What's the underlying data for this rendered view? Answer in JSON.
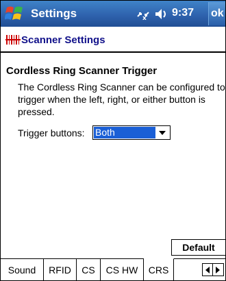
{
  "titlebar": {
    "app_title": "Settings",
    "clock": "9:37",
    "ok_label": "ok",
    "icons": [
      "windows-start-icon",
      "connectivity-icon",
      "volume-icon"
    ]
  },
  "subheader": {
    "title": "Scanner Settings",
    "icon": "scanner-barcode-icon"
  },
  "content": {
    "section_title": "Cordless Ring Scanner Trigger",
    "description": "The Cordless Ring Scanner can be configured to trigger when the left, right, or either button is pressed.",
    "trigger_label": "Trigger buttons:",
    "trigger_value": "Both",
    "default_button": "Default"
  },
  "tabs": [
    {
      "label": "Sound",
      "active": false
    },
    {
      "label": "RFID",
      "active": false
    },
    {
      "label": "CS",
      "active": false
    },
    {
      "label": "CS HW",
      "active": false
    },
    {
      "label": "CRS",
      "active": true
    }
  ],
  "colors": {
    "titlebar": "#2f63ae",
    "subtitle": "#11118a",
    "selection": "#1a5fd6"
  }
}
